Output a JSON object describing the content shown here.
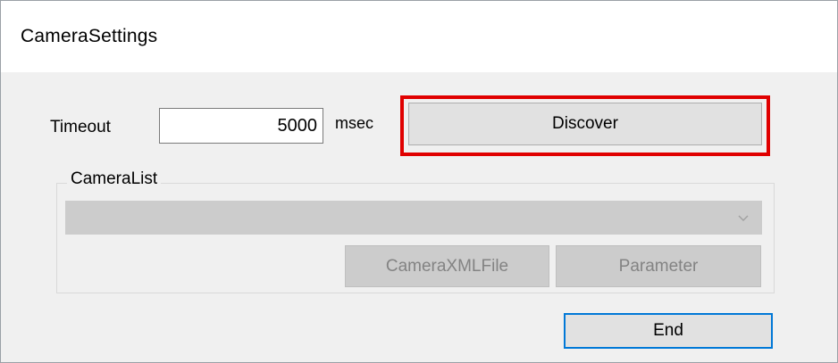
{
  "window": {
    "title": "CameraSettings"
  },
  "timeout": {
    "label": "Timeout",
    "value": "5000",
    "unit": "msec"
  },
  "discover_button": {
    "label": "Discover",
    "highlight_color": "#e00000"
  },
  "camera_list": {
    "group_label": "CameraList",
    "selected_value": "",
    "enabled": false,
    "buttons": {
      "xml_file_label": "CameraXMLFile",
      "parameter_label": "Parameter"
    }
  },
  "end_button": {
    "label": "End",
    "focus_color": "#0078d7"
  },
  "icons": {
    "dropdown": "chevron-down-icon"
  }
}
